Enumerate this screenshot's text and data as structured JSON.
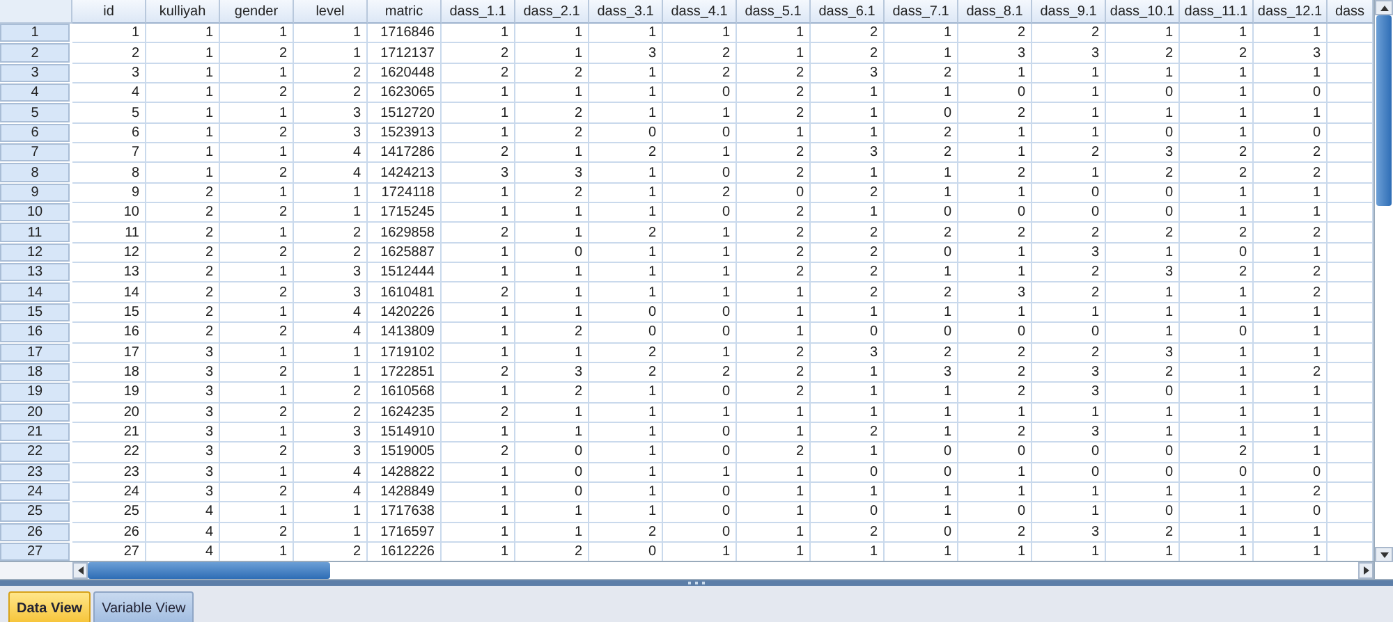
{
  "table": {
    "columns": [
      "id",
      "kulliyah",
      "gender",
      "level",
      "matric",
      "dass_1.1",
      "dass_2.1",
      "dass_3.1",
      "dass_4.1",
      "dass_5.1",
      "dass_6.1",
      "dass_7.1",
      "dass_8.1",
      "dass_9.1",
      "dass_10.1",
      "dass_11.1",
      "dass_12.1",
      "dass"
    ],
    "rows": [
      {
        "label": "1",
        "cells": [
          "1",
          "1",
          "1",
          "1",
          "1716846",
          "1",
          "1",
          "1",
          "1",
          "1",
          "2",
          "1",
          "2",
          "2",
          "1",
          "1",
          "1"
        ]
      },
      {
        "label": "2",
        "cells": [
          "2",
          "1",
          "2",
          "1",
          "1712137",
          "2",
          "1",
          "3",
          "2",
          "1",
          "2",
          "1",
          "3",
          "3",
          "2",
          "2",
          "3"
        ]
      },
      {
        "label": "3",
        "cells": [
          "3",
          "1",
          "1",
          "2",
          "1620448",
          "2",
          "2",
          "1",
          "2",
          "2",
          "3",
          "2",
          "1",
          "1",
          "1",
          "1",
          "1"
        ]
      },
      {
        "label": "4",
        "cells": [
          "4",
          "1",
          "2",
          "2",
          "1623065",
          "1",
          "1",
          "1",
          "0",
          "2",
          "1",
          "1",
          "0",
          "1",
          "0",
          "1",
          "0"
        ]
      },
      {
        "label": "5",
        "cells": [
          "5",
          "1",
          "1",
          "3",
          "1512720",
          "1",
          "2",
          "1",
          "1",
          "2",
          "1",
          "0",
          "2",
          "1",
          "1",
          "1",
          "1"
        ]
      },
      {
        "label": "6",
        "cells": [
          "6",
          "1",
          "2",
          "3",
          "1523913",
          "1",
          "2",
          "0",
          "0",
          "1",
          "1",
          "2",
          "1",
          "1",
          "0",
          "1",
          "0"
        ]
      },
      {
        "label": "7",
        "cells": [
          "7",
          "1",
          "1",
          "4",
          "1417286",
          "2",
          "1",
          "2",
          "1",
          "2",
          "3",
          "2",
          "1",
          "2",
          "3",
          "2",
          "2"
        ]
      },
      {
        "label": "8",
        "cells": [
          "8",
          "1",
          "2",
          "4",
          "1424213",
          "3",
          "3",
          "1",
          "0",
          "2",
          "1",
          "1",
          "2",
          "1",
          "2",
          "2",
          "2"
        ]
      },
      {
        "label": "9",
        "cells": [
          "9",
          "2",
          "1",
          "1",
          "1724118",
          "1",
          "2",
          "1",
          "2",
          "0",
          "2",
          "1",
          "1",
          "0",
          "0",
          "1",
          "1"
        ]
      },
      {
        "label": "10",
        "cells": [
          "10",
          "2",
          "2",
          "1",
          "1715245",
          "1",
          "1",
          "1",
          "0",
          "2",
          "1",
          "0",
          "0",
          "0",
          "0",
          "1",
          "1"
        ]
      },
      {
        "label": "11",
        "cells": [
          "11",
          "2",
          "1",
          "2",
          "1629858",
          "2",
          "1",
          "2",
          "1",
          "2",
          "2",
          "2",
          "2",
          "2",
          "2",
          "2",
          "2"
        ]
      },
      {
        "label": "12",
        "cells": [
          "12",
          "2",
          "2",
          "2",
          "1625887",
          "1",
          "0",
          "1",
          "1",
          "2",
          "2",
          "0",
          "1",
          "3",
          "1",
          "0",
          "1"
        ]
      },
      {
        "label": "13",
        "cells": [
          "13",
          "2",
          "1",
          "3",
          "1512444",
          "1",
          "1",
          "1",
          "1",
          "2",
          "2",
          "1",
          "1",
          "2",
          "3",
          "2",
          "2"
        ]
      },
      {
        "label": "14",
        "cells": [
          "14",
          "2",
          "2",
          "3",
          "1610481",
          "2",
          "1",
          "1",
          "1",
          "1",
          "2",
          "2",
          "3",
          "2",
          "1",
          "1",
          "2"
        ]
      },
      {
        "label": "15",
        "cells": [
          "15",
          "2",
          "1",
          "4",
          "1420226",
          "1",
          "1",
          "0",
          "0",
          "1",
          "1",
          "1",
          "1",
          "1",
          "1",
          "1",
          "1"
        ]
      },
      {
        "label": "16",
        "cells": [
          "16",
          "2",
          "2",
          "4",
          "1413809",
          "1",
          "2",
          "0",
          "0",
          "1",
          "0",
          "0",
          "0",
          "0",
          "1",
          "0",
          "1"
        ]
      },
      {
        "label": "17",
        "cells": [
          "17",
          "3",
          "1",
          "1",
          "1719102",
          "1",
          "1",
          "2",
          "1",
          "2",
          "3",
          "2",
          "2",
          "2",
          "3",
          "1",
          "1"
        ]
      },
      {
        "label": "18",
        "cells": [
          "18",
          "3",
          "2",
          "1",
          "1722851",
          "2",
          "3",
          "2",
          "2",
          "2",
          "1",
          "3",
          "2",
          "3",
          "2",
          "1",
          "2"
        ]
      },
      {
        "label": "19",
        "cells": [
          "19",
          "3",
          "1",
          "2",
          "1610568",
          "1",
          "2",
          "1",
          "0",
          "2",
          "1",
          "1",
          "2",
          "3",
          "0",
          "1",
          "1"
        ]
      },
      {
        "label": "20",
        "cells": [
          "20",
          "3",
          "2",
          "2",
          "1624235",
          "2",
          "1",
          "1",
          "1",
          "1",
          "1",
          "1",
          "1",
          "1",
          "1",
          "1",
          "1"
        ]
      },
      {
        "label": "21",
        "cells": [
          "21",
          "3",
          "1",
          "3",
          "1514910",
          "1",
          "1",
          "1",
          "0",
          "1",
          "2",
          "1",
          "2",
          "3",
          "1",
          "1",
          "1"
        ]
      },
      {
        "label": "22",
        "cells": [
          "22",
          "3",
          "2",
          "3",
          "1519005",
          "2",
          "0",
          "1",
          "0",
          "2",
          "1",
          "0",
          "0",
          "0",
          "0",
          "2",
          "1"
        ]
      },
      {
        "label": "23",
        "cells": [
          "23",
          "3",
          "1",
          "4",
          "1428822",
          "1",
          "0",
          "1",
          "1",
          "1",
          "0",
          "0",
          "1",
          "0",
          "0",
          "0",
          "0"
        ]
      },
      {
        "label": "24",
        "cells": [
          "24",
          "3",
          "2",
          "4",
          "1428849",
          "1",
          "0",
          "1",
          "0",
          "1",
          "1",
          "1",
          "1",
          "1",
          "1",
          "1",
          "2"
        ]
      },
      {
        "label": "25",
        "cells": [
          "25",
          "4",
          "1",
          "1",
          "1717638",
          "1",
          "1",
          "1",
          "0",
          "1",
          "0",
          "1",
          "0",
          "1",
          "0",
          "1",
          "0"
        ]
      },
      {
        "label": "26",
        "cells": [
          "26",
          "4",
          "2",
          "1",
          "1716597",
          "1",
          "1",
          "2",
          "0",
          "1",
          "2",
          "0",
          "2",
          "3",
          "2",
          "1",
          "1"
        ]
      },
      {
        "label": "27",
        "cells": [
          "27",
          "4",
          "1",
          "2",
          "1612226",
          "1",
          "2",
          "0",
          "1",
          "1",
          "1",
          "1",
          "1",
          "1",
          "1",
          "1",
          "1"
        ]
      }
    ]
  },
  "tabs": [
    {
      "label": "Data View",
      "selected": true
    },
    {
      "label": "Variable View",
      "selected": false
    }
  ]
}
